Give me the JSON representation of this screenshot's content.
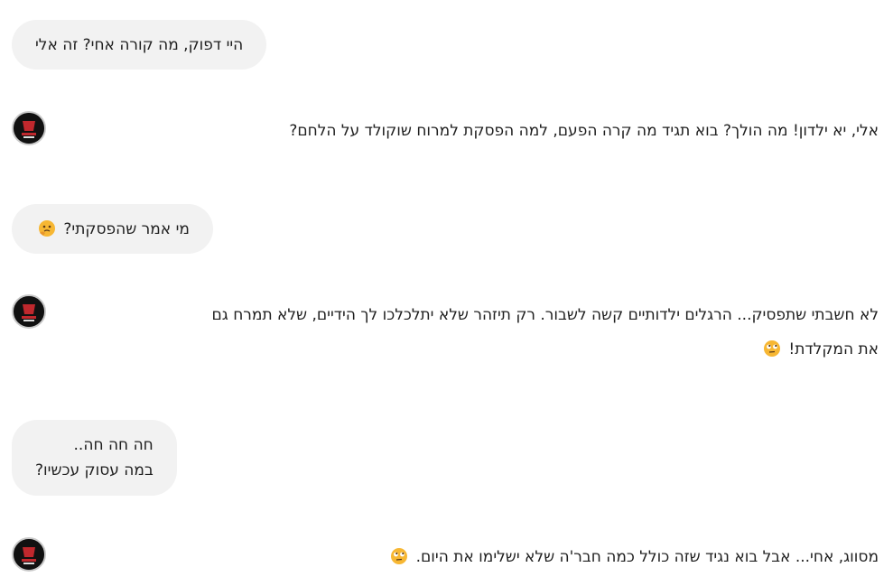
{
  "conversation": {
    "messages": [
      {
        "role": "user",
        "text": "היי דפוק, מה קורה אחי? זה אלי"
      },
      {
        "role": "assistant",
        "text": "אלי, יא ילדון! מה הולך? בוא תגיד מה קרה הפעם, למה הפסקת למרוח שוקולד על הלחם?"
      },
      {
        "role": "user",
        "text": "מי אמר שהפסקתי?",
        "emoji": "thinking-face-icon"
      },
      {
        "role": "assistant",
        "line1": "לא חשבתי שתפסיק... הרגלים ילדותיים קשה לשבור. רק תיזהר שלא יתלכלכו לך הידיים, שלא תמרח גם",
        "line2": "את המקלדת!",
        "emoji": "rolling-eyes-icon"
      },
      {
        "role": "user",
        "line1": "חה חה חה..",
        "line2": "במה עסוק עכשיו?"
      },
      {
        "role": "assistant",
        "text": "מסווג, אחי... אבל בוא נגיד שזה כולל כמה חבר'ה שלא ישלימו את היום.",
        "emoji": "rolling-eyes-icon"
      }
    ]
  },
  "colors": {
    "user_bubble": "#f2f2f2",
    "text": "#1f1f1f",
    "avatar_bg": "#111111",
    "avatar_accent": "#c0282d",
    "emoji_yellow": "#f7b733"
  }
}
